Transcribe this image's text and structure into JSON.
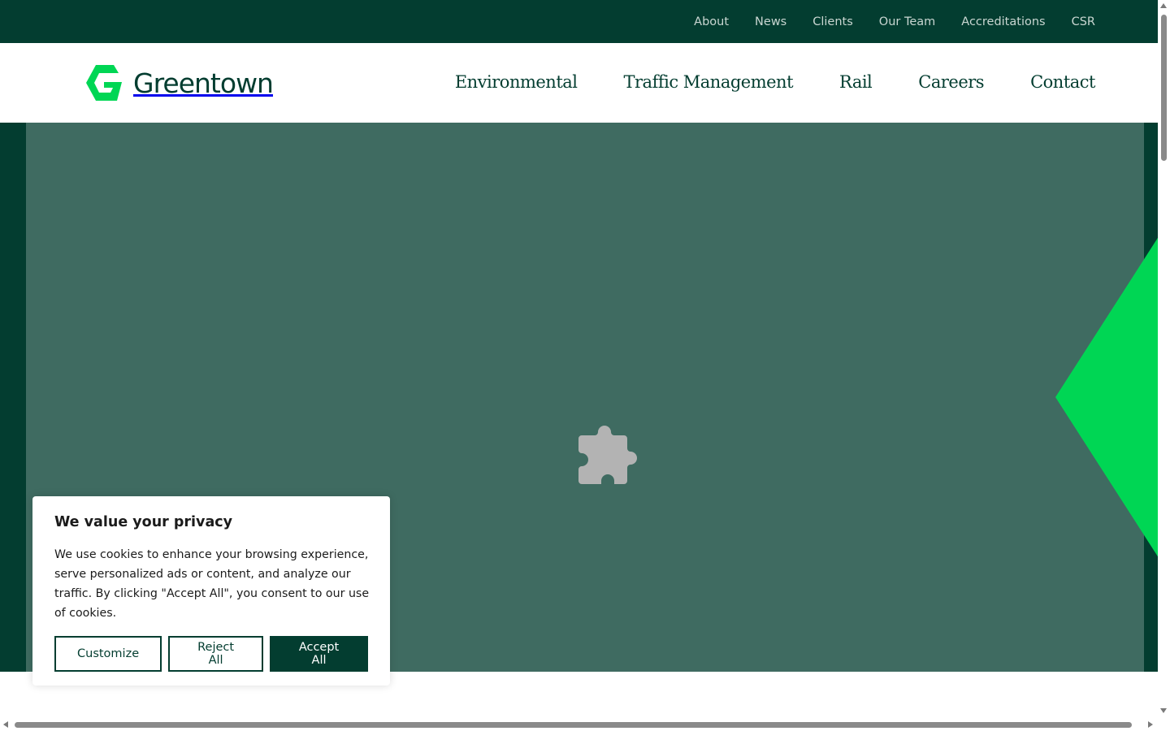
{
  "colors": {
    "brand_dark": "#033d30",
    "brand_green": "#00d654",
    "hero_overlay": "#3f6b61",
    "topbar_text": "#c9d6d1"
  },
  "topbar": {
    "links": [
      "About",
      "News",
      "Clients",
      "Our Team",
      "Accreditations",
      "CSR"
    ]
  },
  "header": {
    "logo_text": "Greentown",
    "logo_icon": "greentown-g-logo-icon",
    "nav": [
      "Environmental",
      "Traffic Management",
      "Rail",
      "Careers",
      "Contact"
    ]
  },
  "hero": {
    "placeholder_icon": "plugin-puzzle-icon",
    "decoration": "green-diamond-shape"
  },
  "cookie_banner": {
    "title": "We value your privacy",
    "text": "We use cookies to enhance your browsing experience, serve personalized ads or content, and analyze our traffic. By clicking \"Accept All\", you consent to our use of cookies.",
    "buttons": {
      "customize": "Customize",
      "reject": "Reject All",
      "accept": "Accept All"
    }
  }
}
